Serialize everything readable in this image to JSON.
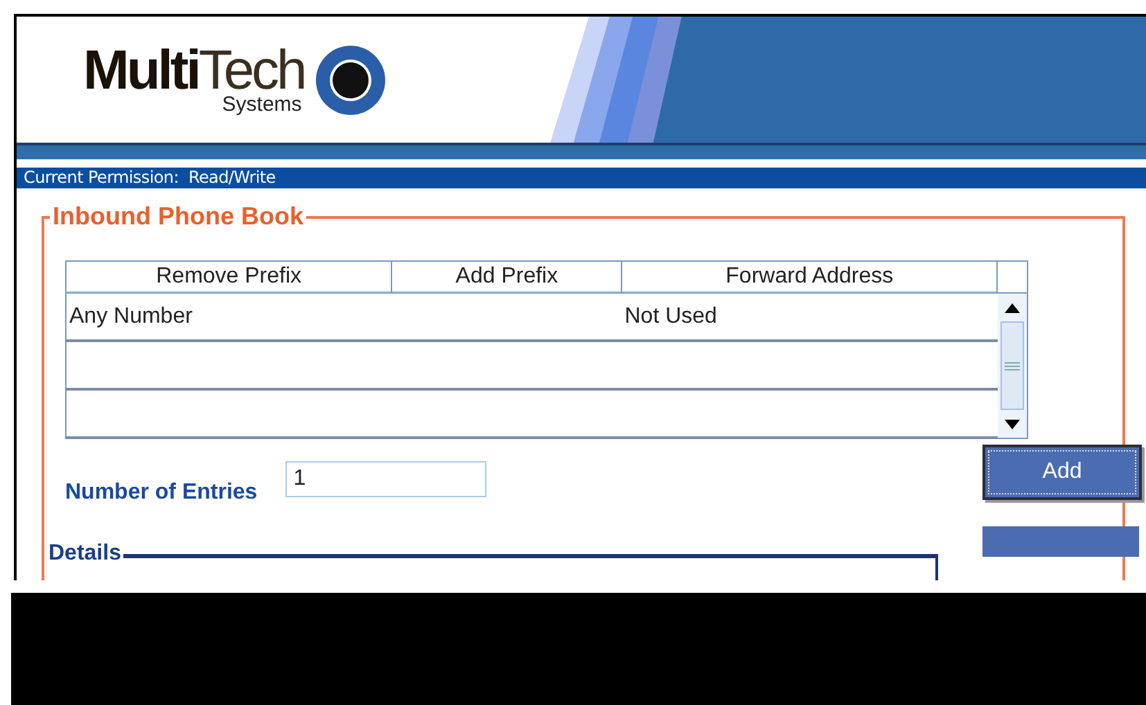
{
  "logo": {
    "bold": "Multi",
    "light": "Tech",
    "tagline": "Systems"
  },
  "permission_bar": {
    "text": "Current Permission:  Read/Write"
  },
  "phone_book": {
    "title": "Inbound Phone Book",
    "table": {
      "columns": [
        "Remove Prefix",
        "Add Prefix",
        "Forward Address"
      ],
      "rows": [
        [
          "Any Number",
          "",
          "Not Used"
        ],
        [
          "",
          "",
          ""
        ],
        [
          "",
          "",
          ""
        ]
      ]
    },
    "entries_label": "Number of Entries",
    "entries_value": "1",
    "buttons": [
      {
        "label": "Add"
      }
    ],
    "details_title": "Details"
  }
}
